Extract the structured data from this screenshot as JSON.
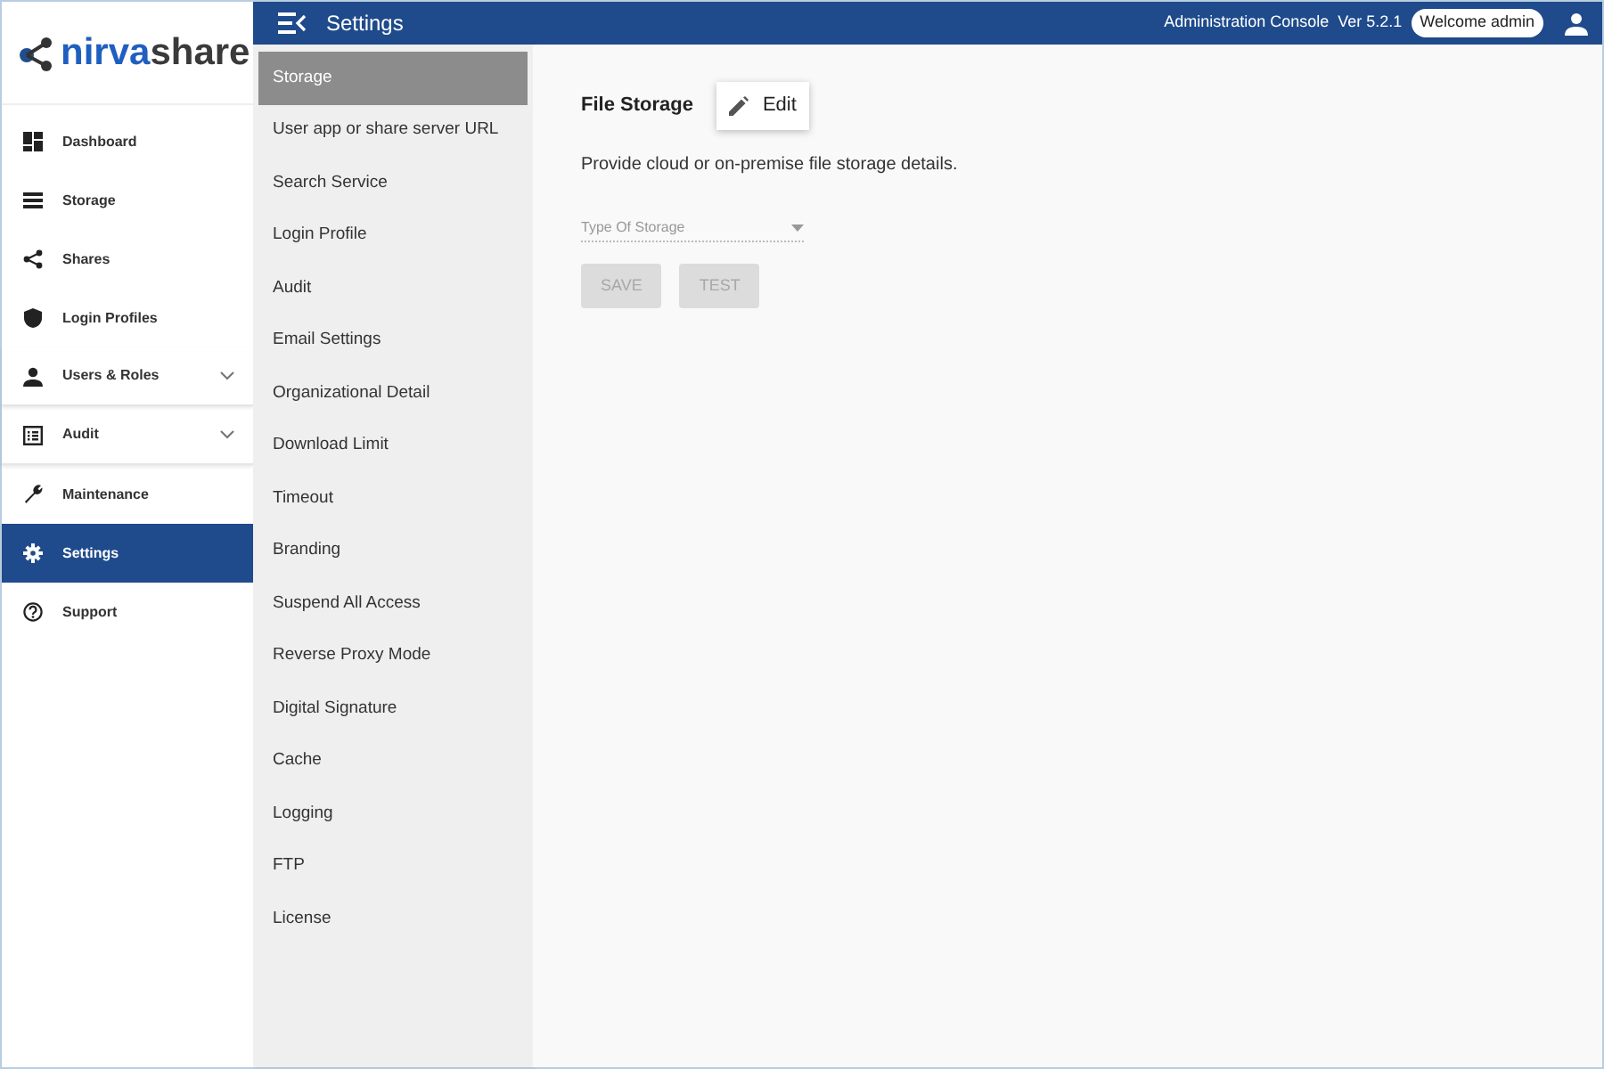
{
  "logo": {
    "part_1": "nirva",
    "part_2": "share"
  },
  "nav": [
    {
      "label": "Dashboard",
      "kind": "dashboard",
      "selected": false
    },
    {
      "label": "Storage",
      "kind": "storage",
      "selected": false
    },
    {
      "label": "Shares",
      "kind": "share",
      "selected": false
    },
    {
      "label": "Login Profiles",
      "kind": "shield",
      "selected": false
    },
    {
      "label": "Users & Roles",
      "kind": "person",
      "selected": false,
      "expanded": false
    },
    {
      "label": "Audit",
      "kind": "list",
      "selected": false,
      "expanded": false
    },
    {
      "label": "Maintenance",
      "kind": "wrench",
      "selected": false
    },
    {
      "label": "Settings",
      "kind": "gear",
      "selected": true
    },
    {
      "label": "Support",
      "kind": "help",
      "selected": false
    }
  ],
  "top_bar": {
    "title": "Settings",
    "console": "Administration Console",
    "version": "Ver 5.2.1",
    "welcome": "Welcome admin"
  },
  "settings_menu": [
    {
      "label": "Storage",
      "selected": true
    },
    {
      "label": "User app or share server URL",
      "selected": false
    },
    {
      "label": "Search Service",
      "selected": false
    },
    {
      "label": "Login Profile",
      "selected": false
    },
    {
      "label": "Audit",
      "selected": false
    },
    {
      "label": "Email Settings",
      "selected": false
    },
    {
      "label": "Organizational Detail",
      "selected": false
    },
    {
      "label": "Download Limit",
      "selected": false
    },
    {
      "label": "Timeout",
      "selected": false
    },
    {
      "label": "Branding",
      "selected": false
    },
    {
      "label": "Suspend All Access",
      "selected": false
    },
    {
      "label": "Reverse Proxy Mode",
      "selected": false
    },
    {
      "label": "Digital Signature",
      "selected": false
    },
    {
      "label": "Cache",
      "selected": false
    },
    {
      "label": "Logging",
      "selected": false
    },
    {
      "label": "FTP",
      "selected": false
    },
    {
      "label": "License",
      "selected": false
    }
  ],
  "content": {
    "title": "File Storage",
    "edit_button": "Edit",
    "description": "Provide cloud or on-premise file storage details.",
    "storage_type": {
      "placeholder": "Type Of Storage"
    },
    "buttons": [
      {
        "label": "SAVE",
        "disabled": true
      },
      {
        "label": "TEST",
        "disabled": true
      }
    ]
  }
}
